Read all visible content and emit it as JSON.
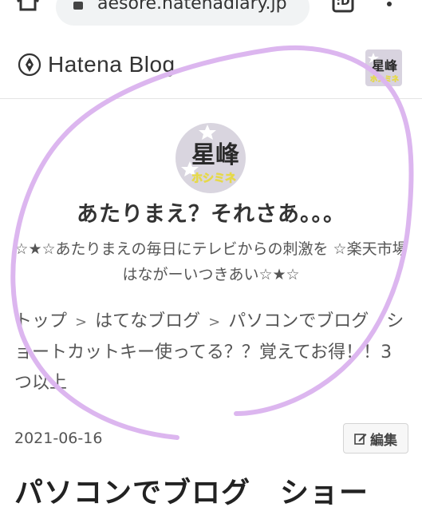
{
  "browser": {
    "url": "aesore.hatenadiary.jp",
    "tab_count": ":D",
    "icons": {
      "home": "home-icon",
      "lock": "lock-icon",
      "tabs": "tabs-icon",
      "menu": "more-vert-icon"
    }
  },
  "header": {
    "logo_text": "Hatena Blog",
    "logo_icon": "pen-nib-icon"
  },
  "blog": {
    "avatar_text": "星峰",
    "avatar_subtext": "ホシミネ",
    "title": "あたりまえ？それさあ。。。",
    "description": "☆★☆あたりまえの毎日にテレビからの刺激を ☆楽天市場はながーいつきあい☆★☆"
  },
  "breadcrumb": {
    "items": [
      "トップ",
      "はてなブログ",
      "パソコンでブログ　ショートカットキー使ってる？？覚えてお得！！3つ以上"
    ],
    "separator": ">"
  },
  "entry": {
    "date": "2021-06-16",
    "edit_label": "編集",
    "title": "パソコンでブログ　ショー"
  },
  "colors": {
    "annotation_circle": "#dcb6ef",
    "avatar_bg": "#d9d5df",
    "avatar_text": "#2a2a2a",
    "avatar_subtext": "#e6d94a"
  }
}
